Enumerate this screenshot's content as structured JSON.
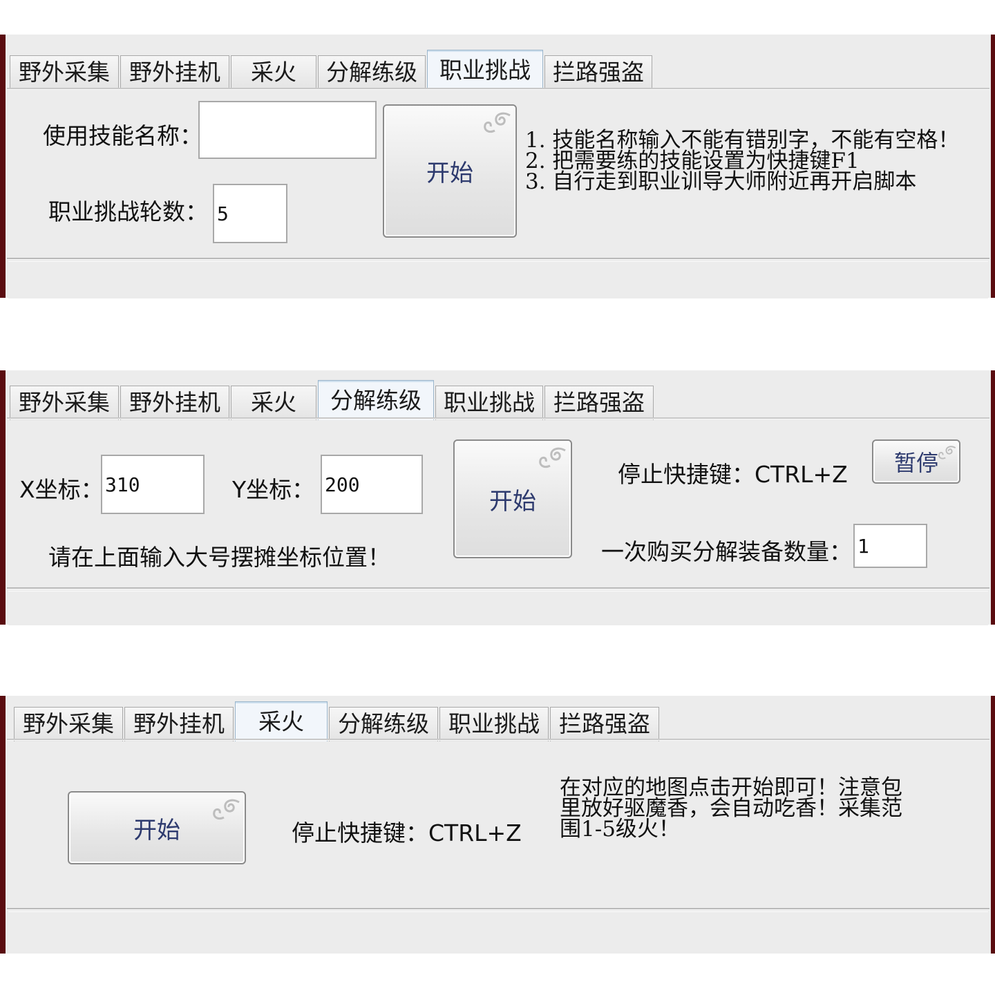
{
  "tabs": [
    "野外采集",
    "野外挂机",
    "采火",
    "分解练级",
    "职业挑战",
    "拦路强盗"
  ],
  "panel1": {
    "active_tab": "职业挑战",
    "skill_label": "使用技能名称：",
    "skill_value": "",
    "rounds_label": "职业挑战轮数：",
    "rounds_value": "5",
    "start_button": "开始",
    "notes": [
      "1. 技能名称输入不能有错别字，不能有空格！",
      "2. 把需要练的技能设置为快捷键F1",
      "3. 自行走到职业训导大师附近再开启脚本"
    ]
  },
  "panel2": {
    "active_tab": "分解练级",
    "x_label": "X坐标：",
    "x_value": "310",
    "y_label": "Y坐标：",
    "y_value": "200",
    "hint": "请在上面输入大号摆摊坐标位置！",
    "start_button": "开始",
    "stop_hotkey": "停止快捷键：CTRL+Z",
    "pause_button": "暂停",
    "buy_label": "一次购买分解装备数量：",
    "buy_value": "1"
  },
  "panel3": {
    "active_tab": "采火",
    "start_button": "开始",
    "stop_hotkey": "停止快捷键：CTRL+Z",
    "notes": [
      "在对应的地图点击开始即可！注意包",
      "里放好驱魔香，会自动吃香！采集范",
      "围1-5级火！"
    ]
  }
}
